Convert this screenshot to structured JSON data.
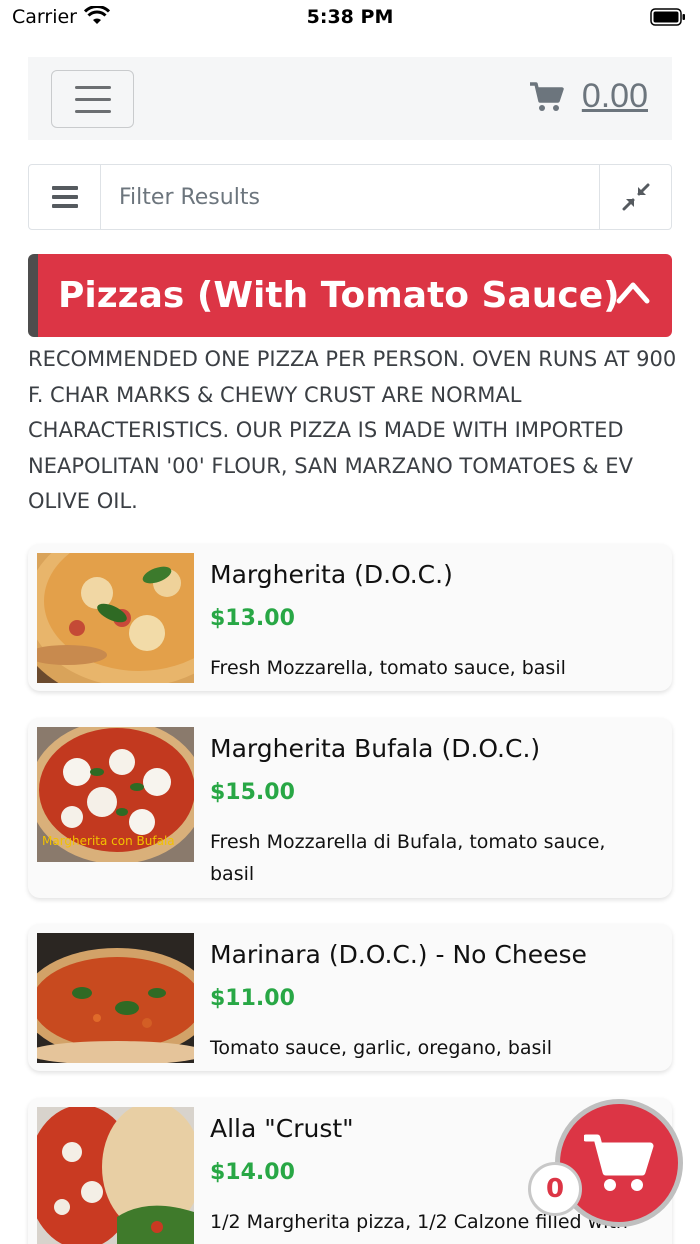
{
  "status_bar": {
    "carrier": "Carrier",
    "time": "5:38 PM"
  },
  "navbar": {
    "cart_total": "0.00"
  },
  "filter": {
    "placeholder": "Filter Results"
  },
  "category": {
    "title": "Pizzas (With Tomato Sauce)",
    "description": "RECOMMENDED ONE PIZZA PER PERSON. OVEN RUNS AT 900 F. CHAR MARKS & CHEWY CRUST ARE NORMAL CHARACTERISTICS. OUR PIZZA IS MADE WITH IMPORTED NEAPOLITAN '00' FLOUR, SAN MARZANO TOMATOES & EV OLIVE OIL."
  },
  "items": [
    {
      "name": "Margherita (D.O.C.)",
      "price": "$13.00",
      "description": "Fresh Mozzarella, tomato sauce, basil"
    },
    {
      "name": "Margherita Bufala (D.O.C.)",
      "price": "$15.00",
      "description": "Fresh Mozzarella di Bufala, tomato sauce, basil",
      "image_caption": "Margherita con Bufala"
    },
    {
      "name": "Marinara (D.O.C.) - No Cheese",
      "price": "$11.00",
      "description": "Tomato sauce, garlic, oregano, basil"
    },
    {
      "name": "Alla \"Crust\"",
      "price": "$14.00",
      "description": "1/2 Margherita pizza, 1/2 Calzone filled with"
    }
  ],
  "floating_cart": {
    "count": "0"
  },
  "colors": {
    "accent_red": "#dc3545",
    "price_green": "#28a745"
  }
}
